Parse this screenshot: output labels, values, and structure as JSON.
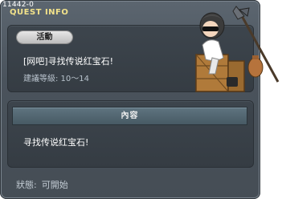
{
  "window": {
    "quest_id": "11442-0",
    "title": "QUEST INFO"
  },
  "info": {
    "category": "活動",
    "quest_name": "[网吧]寻找传说红宝石!",
    "level_range": "建議等級: 10～14"
  },
  "content": {
    "header": "內容",
    "description": "寻找传说红宝石!"
  },
  "status": {
    "label": "狀態:",
    "value": "可開始"
  },
  "colors": {
    "title": "#f2e28a",
    "panel": "#3d454d",
    "header_bar": "#5f7480"
  },
  "icons": [
    "npc-portrait"
  ]
}
